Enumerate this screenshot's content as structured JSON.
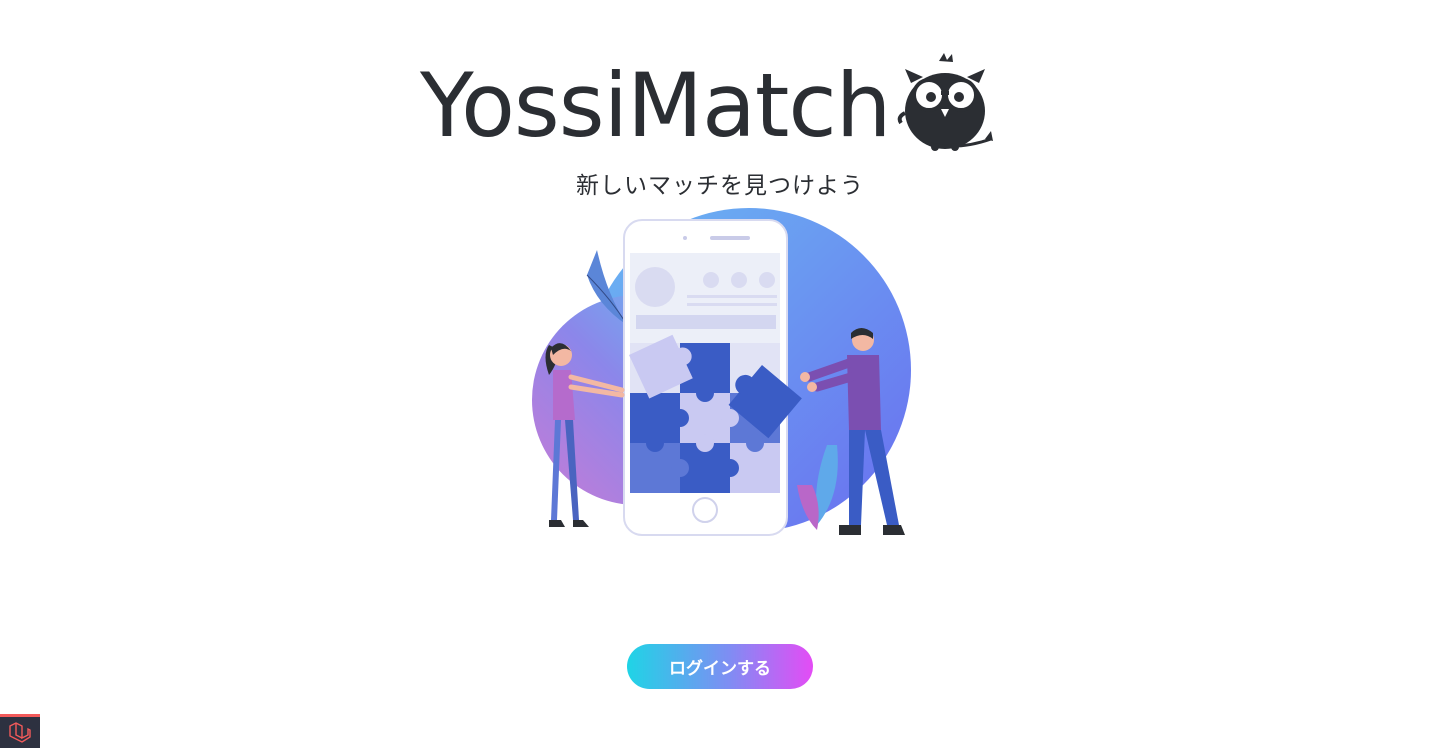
{
  "brand": {
    "name": "YossiMatch",
    "icon": "owl-icon"
  },
  "tagline": "新しいマッチを見つけよう",
  "hero": {
    "icon": "puzzle-match-illustration"
  },
  "login_button": {
    "label": "ログインする"
  },
  "debug_bar": {
    "icon": "laravel-icon"
  },
  "colors": {
    "text": "#2b2e33",
    "button_gradient_start": "#1fd4e6",
    "button_gradient_end": "#e44cf5",
    "puzzle_blue": "#3a5cc5",
    "circle_gradient_start": "#d07dd9",
    "circle_gradient_end": "#6a73f0"
  }
}
